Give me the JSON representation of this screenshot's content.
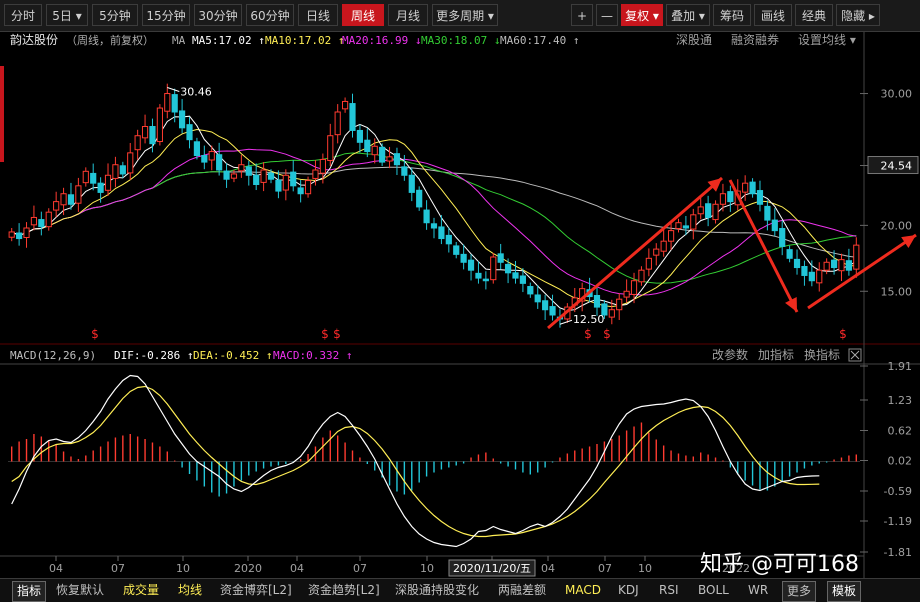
{
  "toolbar": {
    "left_items": [
      {
        "label": "分时",
        "active": false
      },
      {
        "label": "5日 ▾",
        "active": false
      },
      {
        "label": "5分钟",
        "active": false
      },
      {
        "label": "15分钟",
        "active": false
      },
      {
        "label": "30分钟",
        "active": false
      },
      {
        "label": "60分钟",
        "active": false
      },
      {
        "label": "日线",
        "active": false
      },
      {
        "label": "周线",
        "active": true
      },
      {
        "label": "月线",
        "active": false
      },
      {
        "label": "更多周期 ▾",
        "active": false
      }
    ],
    "right_items": [
      {
        "label": "+",
        "active": false
      },
      {
        "label": "—",
        "active": false
      },
      {
        "label": "复权 ▾",
        "active": true
      },
      {
        "label": "叠加 ▾",
        "active": false
      },
      {
        "label": "筹码",
        "active": false
      },
      {
        "label": "画线",
        "active": false
      },
      {
        "label": "经典",
        "active": false
      },
      {
        "label": "隐藏 ▸",
        "active": false
      }
    ]
  },
  "price_panel": {
    "stock_name": "韵达股份",
    "mode": "（周线，前复权）",
    "ma_label": "MA",
    "ma5": "MA5:17.02 ↑",
    "ma10": "MA10:17.02 ↑",
    "ma20": "MA20:16.99 ↓",
    "ma30": "MA30:18.07 ↓",
    "ma60": "MA60:17.40 ↑",
    "links": [
      "深股通",
      "融资融券",
      "设置均线 ▾"
    ],
    "high_label": "30.46",
    "low_label": "12.50",
    "price_axis": [
      "30.00",
      "24.54",
      "20.00",
      "15.00"
    ],
    "markers": [
      "$",
      "$",
      "$",
      "$",
      "$",
      "$"
    ]
  },
  "macd_panel": {
    "title": "MACD(12,26,9)",
    "dif": "DIF:-0.286 ↑",
    "dea": "DEA:-0.452 ↑",
    "macd": "MACD:0.332 ↑",
    "links": [
      "改参数",
      "加指标",
      "换指标"
    ],
    "axis": [
      "1.91",
      "1.23",
      "0.62",
      "0.02",
      "-0.59",
      "-1.19",
      "-1.81"
    ]
  },
  "time_axis": {
    "labels": [
      "04",
      "07",
      "10",
      "2020",
      "04",
      "07",
      "10",
      "2020/11/20/五",
      "04",
      "07",
      "10",
      "2022"
    ]
  },
  "bottom_tabs": [
    {
      "label": "指标",
      "color": "#ffffff",
      "box": true
    },
    {
      "label": "恢复默认",
      "color": "#c0c0c0",
      "box": false
    },
    {
      "label": "成交量",
      "color": "#ffee55",
      "box": false
    },
    {
      "label": "均线",
      "color": "#ffee55",
      "box": false
    },
    {
      "label": "资金博弈[L2]",
      "color": "#c0c0c0",
      "box": false
    },
    {
      "label": "资金趋势[L2]",
      "color": "#c0c0c0",
      "box": false
    },
    {
      "label": "深股通持股变化",
      "color": "#c0c0c0",
      "box": false
    },
    {
      "label": "两融差额",
      "color": "#c0c0c0",
      "box": false
    },
    {
      "label": "MACD",
      "color": "#ffee55",
      "box": false
    },
    {
      "label": "KDJ",
      "color": "#c0c0c0",
      "box": false
    },
    {
      "label": "RSI",
      "color": "#c0c0c0",
      "box": false
    },
    {
      "label": "BOLL",
      "color": "#c0c0c0",
      "box": false
    },
    {
      "label": "WR",
      "color": "#c0c0c0",
      "box": false
    },
    {
      "label": "更多",
      "color": "#c0c0c0",
      "box": true
    },
    {
      "label": "模板",
      "color": "#ffffff",
      "box": true
    }
  ],
  "watermark": "知乎 @可可168",
  "colors": {
    "up": "#ff3b30",
    "down": "#22c6d8",
    "ma5": "#ffffff",
    "ma10": "#ffee55",
    "ma20": "#ee33ee",
    "ma30": "#33cc33",
    "ma60": "#bbbbbb",
    "arrow": "#ee2b1e"
  },
  "chart_data": {
    "type": "candlestick",
    "price_ylim": [
      11.0,
      33.0
    ],
    "close_series": [
      19.5,
      19.0,
      19.8,
      20.6,
      19.9,
      21.0,
      21.8,
      22.4,
      21.6,
      23.0,
      24.1,
      23.2,
      22.5,
      23.8,
      24.6,
      23.9,
      25.5,
      26.8,
      27.5,
      26.2,
      28.9,
      30.0,
      28.6,
      27.4,
      26.5,
      25.3,
      24.8,
      25.6,
      24.2,
      23.5,
      23.9,
      24.6,
      23.8,
      23.1,
      24.2,
      23.5,
      22.6,
      23.8,
      23.0,
      22.4,
      23.4,
      24.2,
      25.0,
      26.8,
      28.6,
      29.4,
      27.2,
      26.3,
      25.6,
      26.0,
      24.8,
      25.2,
      24.6,
      23.8,
      22.5,
      21.4,
      20.2,
      19.8,
      19.0,
      18.6,
      17.8,
      17.2,
      16.6,
      16.0,
      15.8,
      17.6,
      17.2,
      16.4,
      16.0,
      15.6,
      14.8,
      14.2,
      13.6,
      13.2,
      12.9,
      13.8,
      14.5,
      15.2,
      14.6,
      13.8,
      13.2,
      13.6,
      14.4,
      15.0,
      15.8,
      16.6,
      17.5,
      18.2,
      18.8,
      19.6,
      20.2,
      19.8,
      20.8,
      21.4,
      20.6,
      21.6,
      22.4,
      21.8,
      22.6,
      23.2,
      22.4,
      21.6,
      20.4,
      19.6,
      18.4,
      17.5,
      16.8,
      16.2,
      15.8,
      16.6,
      17.2,
      16.8,
      17.4,
      16.6,
      18.5
    ],
    "low_marker": 12.5,
    "high_marker": 30.46,
    "macd_ylim": [
      -1.81,
      1.91
    ],
    "macd_hist": [
      0.3,
      0.4,
      0.45,
      0.55,
      0.5,
      0.42,
      0.35,
      0.2,
      0.1,
      0.05,
      0.12,
      0.22,
      0.3,
      0.4,
      0.48,
      0.52,
      0.55,
      0.5,
      0.45,
      0.38,
      0.3,
      0.2,
      0.02,
      -0.12,
      -0.25,
      -0.38,
      -0.5,
      -0.62,
      -0.7,
      -0.64,
      -0.5,
      -0.38,
      -0.28,
      -0.2,
      -0.14,
      -0.1,
      -0.08,
      -0.05,
      -0.02,
      0.05,
      0.15,
      0.3,
      0.48,
      0.62,
      0.52,
      0.38,
      0.22,
      0.08,
      -0.05,
      -0.18,
      -0.32,
      -0.48,
      -0.6,
      -0.66,
      -0.58,
      -0.42,
      -0.3,
      -0.22,
      -0.16,
      -0.12,
      -0.08,
      -0.04,
      0.08,
      0.14,
      0.18,
      0.06,
      -0.04,
      -0.1,
      -0.16,
      -0.22,
      -0.26,
      -0.22,
      -0.12,
      -0.02,
      0.08,
      0.16,
      0.22,
      0.26,
      0.3,
      0.35,
      0.4,
      0.45,
      0.52,
      0.62,
      0.7,
      0.78,
      0.58,
      0.44,
      0.32,
      0.22,
      0.16,
      0.12,
      0.1,
      0.18,
      0.14,
      0.08,
      0.02,
      -0.12,
      -0.26,
      -0.38,
      -0.48,
      -0.56,
      -0.58,
      -0.5,
      -0.4,
      -0.3,
      -0.22,
      -0.14,
      -0.08,
      -0.04,
      -0.02,
      0.04,
      0.08,
      0.12,
      0.14
    ],
    "dif": [
      -0.85,
      -0.55,
      -0.2,
      0.1,
      0.3,
      0.42,
      0.45,
      0.4,
      0.38,
      0.48,
      0.62,
      0.8,
      1.0,
      1.25,
      1.45,
      1.62,
      1.72,
      1.7,
      1.55,
      1.3,
      1.05,
      0.8,
      0.55,
      0.35,
      0.15,
      0.0,
      -0.1,
      -0.2,
      -0.3,
      -0.45,
      -0.55,
      -0.6,
      -0.52,
      -0.4,
      -0.28,
      -0.18,
      -0.12,
      -0.08,
      -0.02,
      0.1,
      0.3,
      0.55,
      0.75,
      0.9,
      0.98,
      0.9,
      0.72,
      0.52,
      0.3,
      0.05,
      -0.25,
      -0.55,
      -0.85,
      -1.1,
      -1.3,
      -1.45,
      -1.55,
      -1.62,
      -1.66,
      -1.68,
      -1.7,
      -1.64,
      -1.55,
      -1.4,
      -1.38,
      -1.3,
      -1.36,
      -1.4,
      -1.44,
      -1.38,
      -1.3,
      -1.25,
      -1.3,
      -1.22,
      -1.1,
      -0.95,
      -0.75,
      -0.55,
      -0.35,
      -0.1,
      0.2,
      0.5,
      0.75,
      0.95,
      1.05,
      1.1,
      1.12,
      1.14,
      1.15,
      1.18,
      1.22,
      1.25,
      1.22,
      1.1,
      0.9,
      0.62,
      0.3,
      0.0,
      -0.25,
      -0.45,
      -0.55,
      -0.58,
      -0.52,
      -0.46,
      -0.4,
      -0.38,
      -0.32,
      -0.3,
      -0.29,
      -0.286
    ],
    "dea": [
      -0.4,
      -0.3,
      -0.1,
      0.05,
      0.18,
      0.28,
      0.34,
      0.36,
      0.36,
      0.4,
      0.48,
      0.58,
      0.72,
      0.9,
      1.08,
      1.26,
      1.4,
      1.48,
      1.5,
      1.44,
      1.32,
      1.15,
      0.95,
      0.75,
      0.55,
      0.38,
      0.22,
      0.08,
      -0.05,
      -0.18,
      -0.3,
      -0.4,
      -0.45,
      -0.46,
      -0.42,
      -0.36,
      -0.3,
      -0.24,
      -0.18,
      -0.1,
      0.0,
      0.15,
      0.3,
      0.45,
      0.6,
      0.68,
      0.7,
      0.66,
      0.56,
      0.42,
      0.25,
      0.05,
      -0.18,
      -0.4,
      -0.6,
      -0.78,
      -0.94,
      -1.08,
      -1.2,
      -1.3,
      -1.38,
      -1.44,
      -1.48,
      -1.5,
      -1.5,
      -1.48,
      -1.47,
      -1.46,
      -1.45,
      -1.42,
      -1.38,
      -1.34,
      -1.3,
      -1.25,
      -1.18,
      -1.1,
      -1.0,
      -0.88,
      -0.75,
      -0.6,
      -0.42,
      -0.25,
      -0.08,
      0.1,
      0.28,
      0.45,
      0.6,
      0.72,
      0.82,
      0.9,
      0.98,
      1.04,
      1.08,
      1.1,
      1.08,
      1.0,
      0.88,
      0.72,
      0.52,
      0.3,
      0.1,
      -0.08,
      -0.22,
      -0.32,
      -0.4,
      -0.44,
      -0.46,
      -0.46,
      -0.455,
      -0.452
    ]
  }
}
